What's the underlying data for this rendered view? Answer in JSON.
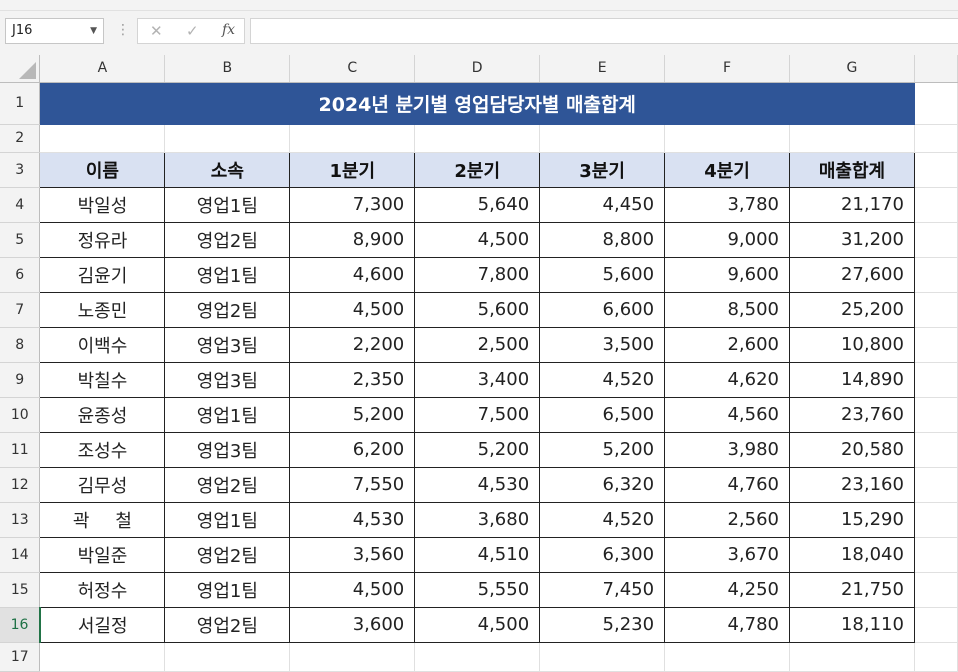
{
  "name_box": {
    "value": "J16"
  },
  "formula_bar": {
    "cancel_glyph": "✕",
    "enter_glyph": "✓",
    "fx_label": "fx",
    "content": ""
  },
  "columns": [
    "A",
    "B",
    "C",
    "D",
    "E",
    "F",
    "G"
  ],
  "row_numbers": [
    "1",
    "2",
    "3",
    "4",
    "5",
    "6",
    "7",
    "8",
    "9",
    "10",
    "11",
    "12",
    "13",
    "14",
    "15",
    "16",
    "17"
  ],
  "selected_row": "16",
  "sheet": {
    "title": "2024년 분기별 영업담당자별 매출합계",
    "headers": [
      "이름",
      "소속",
      "1분기",
      "2분기",
      "3분기",
      "4분기",
      "매출합계"
    ],
    "rows": [
      [
        "박일성",
        "영업1팀",
        "7,300",
        "5,640",
        "4,450",
        "3,780",
        "21,170"
      ],
      [
        "정유라",
        "영업2팀",
        "8,900",
        "4,500",
        "8,800",
        "9,000",
        "31,200"
      ],
      [
        "김윤기",
        "영업1팀",
        "4,600",
        "7,800",
        "5,600",
        "9,600",
        "27,600"
      ],
      [
        "노종민",
        "영업2팀",
        "4,500",
        "5,600",
        "6,600",
        "8,500",
        "25,200"
      ],
      [
        "이백수",
        "영업3팀",
        "2,200",
        "2,500",
        "3,500",
        "2,600",
        "10,800"
      ],
      [
        "박칠수",
        "영업3팀",
        "2,350",
        "3,400",
        "4,520",
        "4,620",
        "14,890"
      ],
      [
        "윤종성",
        "영업1팀",
        "5,200",
        "7,500",
        "6,500",
        "4,560",
        "23,760"
      ],
      [
        "조성수",
        "영업3팀",
        "6,200",
        "5,200",
        "5,200",
        "3,980",
        "20,580"
      ],
      [
        "김무성",
        "영업2팀",
        "7,550",
        "4,530",
        "6,320",
        "4,760",
        "23,160"
      ],
      [
        "곽 철",
        "영업1팀",
        "4,530",
        "3,680",
        "4,520",
        "2,560",
        "15,290"
      ],
      [
        "박일준",
        "영업2팀",
        "3,560",
        "4,510",
        "6,300",
        "3,670",
        "18,040"
      ],
      [
        "허정수",
        "영업1팀",
        "4,500",
        "5,550",
        "7,450",
        "4,250",
        "21,750"
      ],
      [
        "서길정",
        "영업2팀",
        "3,600",
        "4,500",
        "5,230",
        "4,780",
        "18,110"
      ]
    ]
  },
  "colors": {
    "title_fill": "#2f5597",
    "header_fill": "#d9e1f2",
    "selection_green": "#217346"
  }
}
